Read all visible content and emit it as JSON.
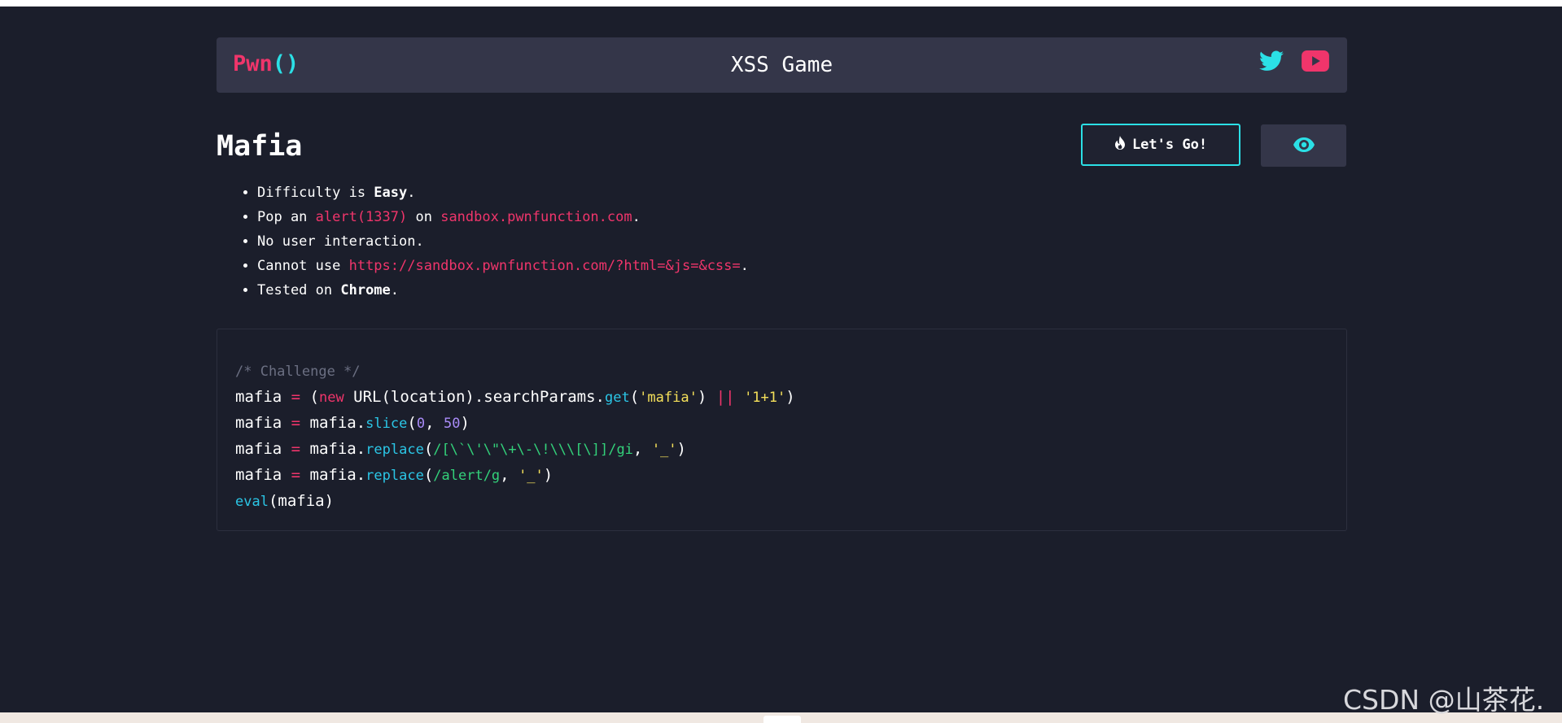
{
  "header": {
    "brand_main": "Pwn",
    "brand_parens": "()",
    "title": "XSS Game",
    "social": [
      {
        "icon": "twitter-icon",
        "color": "#2be0e6"
      },
      {
        "icon": "youtube-icon",
        "color": "#f0356b"
      }
    ]
  },
  "challenge": {
    "title": "Mafia",
    "go_button": {
      "icon": "fire-icon",
      "label": "Let's Go!"
    },
    "view_button": {
      "icon": "eye-icon"
    }
  },
  "rules": [
    {
      "parts": [
        "Difficulty is ",
        "Easy",
        "."
      ]
    },
    {
      "parts": [
        "Pop an ",
        "alert(1337)",
        " on ",
        "sandbox.pwnfunction.com",
        "."
      ]
    },
    {
      "parts": [
        "No user interaction."
      ]
    },
    {
      "parts": [
        "Cannot use ",
        "https://sandbox.pwnfunction.com/?html=&js=&css=",
        "."
      ]
    },
    {
      "parts": [
        "Tested on ",
        "Chrome",
        "."
      ]
    }
  ],
  "code": {
    "comment": "/* Challenge */",
    "line1": {
      "var": "mafia ",
      "eq": "=",
      "open": " (",
      "kw": "new",
      "mid": " URL(location).searchParams.",
      "fn": "get",
      "p1": "(",
      "str": "'mafia'",
      "p2": ") ",
      "op": "||",
      "sp": " ",
      "str2": "'1+1'",
      "end": ")"
    },
    "line2": {
      "var": "mafia ",
      "eq": "=",
      "mid": " mafia.",
      "fn": "slice",
      "p1": "(",
      "n1": "0",
      "comma": ", ",
      "n2": "50",
      "end": ")"
    },
    "line3": {
      "var": "mafia ",
      "eq": "=",
      "mid": " mafia.",
      "fn": "replace",
      "p1": "(",
      "re": "/[\\`\\'\\\"\\+\\-\\!\\\\\\[\\]]/gi",
      "comma": ", ",
      "str": "'_'",
      "end": ")"
    },
    "line4": {
      "var": "mafia ",
      "eq": "=",
      "mid": " mafia.",
      "fn": "replace",
      "p1": "(",
      "re": "/alert/g",
      "comma": ", ",
      "str": "'_'",
      "end": ")"
    },
    "line5": {
      "fn": "eval",
      "rest": "(mafia)"
    }
  },
  "watermark": "CSDN @山茶花."
}
